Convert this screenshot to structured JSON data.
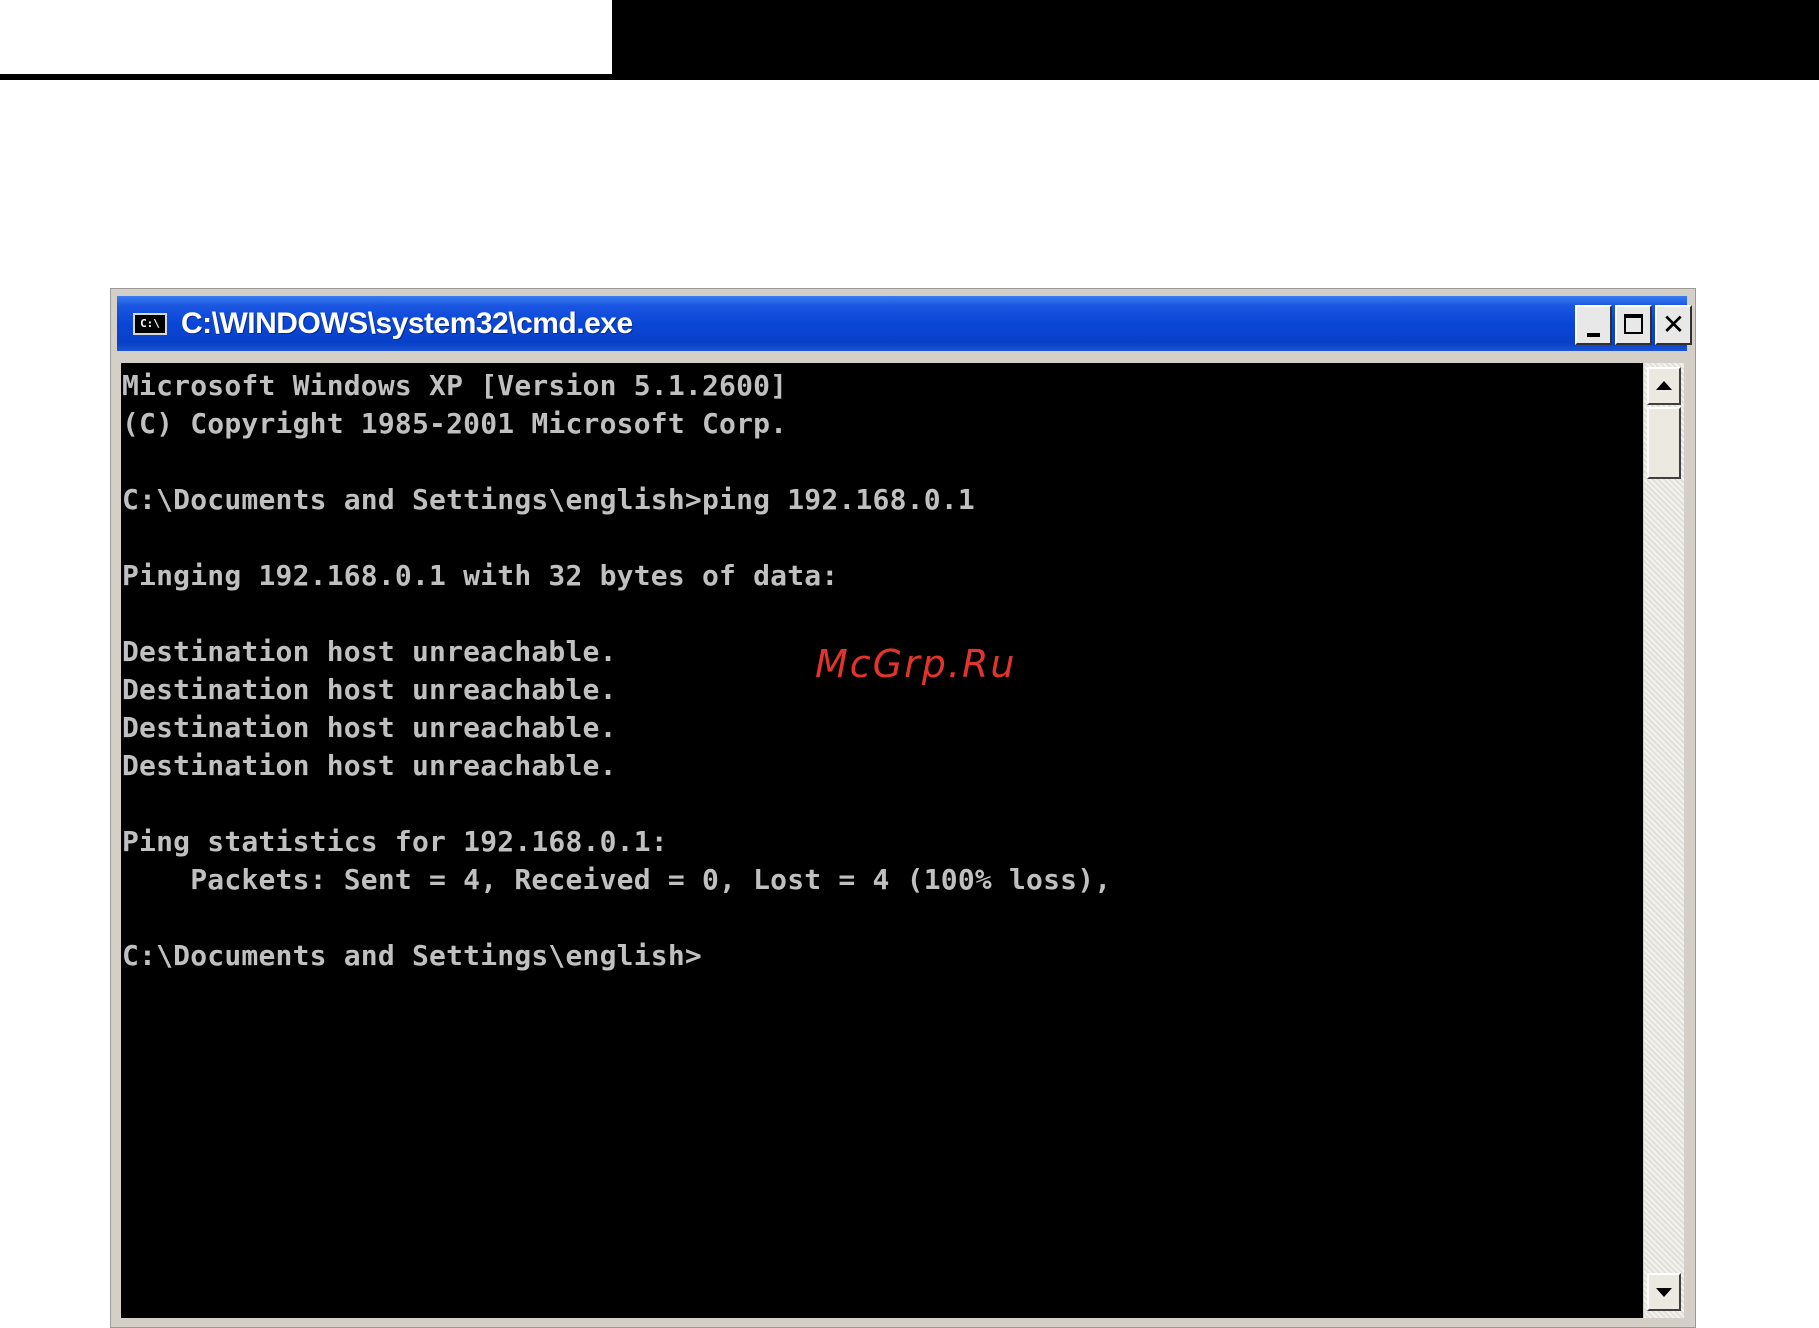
{
  "window": {
    "title": "C:\\WINDOWS\\system32\\cmd.exe",
    "app_icon_text": "C:\\",
    "app_icon": "cmd-prompt-icon",
    "buttons": {
      "minimize": "minimize-icon",
      "maximize": "maximize-icon",
      "close_glyph": "✕"
    }
  },
  "console": {
    "lines": [
      "Microsoft Windows XP [Version 5.1.2600]",
      "(C) Copyright 1985-2001 Microsoft Corp.",
      "",
      "C:\\Documents and Settings\\english>ping 192.168.0.1",
      "",
      "Pinging 192.168.0.1 with 32 bytes of data:",
      "",
      "Destination host unreachable.",
      "Destination host unreachable.",
      "Destination host unreachable.",
      "Destination host unreachable.",
      "",
      "Ping statistics for 192.168.0.1:",
      "    Packets: Sent = 4, Received = 0, Lost = 4 (100% loss),",
      "",
      "C:\\Documents and Settings\\english>"
    ],
    "text_color": "#c0c0c0",
    "background": "#000000"
  },
  "scrollbar": {
    "up_icon": "scroll-up-arrow-icon",
    "down_icon": "scroll-down-arrow-icon"
  },
  "watermark": {
    "text": "McGrp.Ru",
    "color": "#e2342c"
  },
  "colors": {
    "titlebar": "#0a46d6",
    "title_text": "#ffffff"
  }
}
